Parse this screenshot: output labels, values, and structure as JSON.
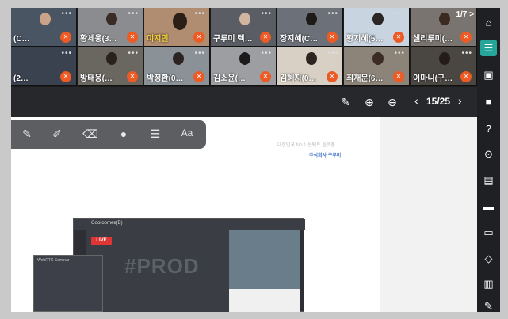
{
  "grid": {
    "counter": "1/7 >",
    "row1": [
      {
        "name": "(C…"
      },
      {
        "name": "황세웅(3…"
      },
      {
        "name": "이지민",
        "highlight": true
      },
      {
        "name": "구루미 텍…"
      },
      {
        "name": "장지혜(C…"
      },
      {
        "name": "황지혜(5…"
      },
      {
        "name": "샐리루미(…"
      }
    ],
    "row2": [
      {
        "name": "(2…"
      },
      {
        "name": "방태웅(…"
      },
      {
        "name": "박정환(0…"
      },
      {
        "name": "김소윤(…"
      },
      {
        "name": "김혜지(0…"
      },
      {
        "name": "최재문(6…"
      },
      {
        "name": "이마니(구…"
      }
    ]
  },
  "toolbar": {
    "page": "15/25",
    "prev_icon": "‹",
    "next_icon": "›"
  },
  "slide": {
    "line1": "대한민국 No.1 온택트 플랫폼",
    "line2": "주식회사 구루미",
    "live": "LIVE",
    "inner_title": "Gooroomee(B)",
    "prod": "#PROD",
    "inner2_title": "WebRTC Seminar"
  },
  "sidebar": {
    "icons": [
      "home-icon",
      "list-icon",
      "contacts-icon",
      "camera-icon",
      "help-icon",
      "search-people-icon",
      "chat-icon",
      "folder-icon",
      "presentation-icon",
      "share-icon",
      "screen-icon",
      "pen-icon"
    ]
  }
}
